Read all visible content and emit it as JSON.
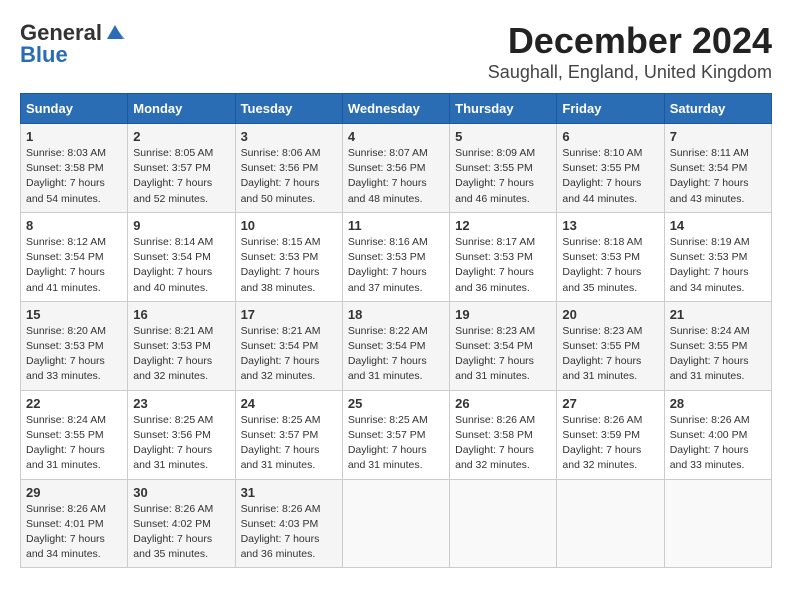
{
  "header": {
    "logo_general": "General",
    "logo_blue": "Blue",
    "month": "December 2024",
    "location": "Saughall, England, United Kingdom"
  },
  "days_of_week": [
    "Sunday",
    "Monday",
    "Tuesday",
    "Wednesday",
    "Thursday",
    "Friday",
    "Saturday"
  ],
  "weeks": [
    [
      {
        "day": 1,
        "sunrise": "8:03 AM",
        "sunset": "3:58 PM",
        "daylight": "7 hours and 54 minutes."
      },
      {
        "day": 2,
        "sunrise": "8:05 AM",
        "sunset": "3:57 PM",
        "daylight": "7 hours and 52 minutes."
      },
      {
        "day": 3,
        "sunrise": "8:06 AM",
        "sunset": "3:56 PM",
        "daylight": "7 hours and 50 minutes."
      },
      {
        "day": 4,
        "sunrise": "8:07 AM",
        "sunset": "3:56 PM",
        "daylight": "7 hours and 48 minutes."
      },
      {
        "day": 5,
        "sunrise": "8:09 AM",
        "sunset": "3:55 PM",
        "daylight": "7 hours and 46 minutes."
      },
      {
        "day": 6,
        "sunrise": "8:10 AM",
        "sunset": "3:55 PM",
        "daylight": "7 hours and 44 minutes."
      },
      {
        "day": 7,
        "sunrise": "8:11 AM",
        "sunset": "3:54 PM",
        "daylight": "7 hours and 43 minutes."
      }
    ],
    [
      {
        "day": 8,
        "sunrise": "8:12 AM",
        "sunset": "3:54 PM",
        "daylight": "7 hours and 41 minutes."
      },
      {
        "day": 9,
        "sunrise": "8:14 AM",
        "sunset": "3:54 PM",
        "daylight": "7 hours and 40 minutes."
      },
      {
        "day": 10,
        "sunrise": "8:15 AM",
        "sunset": "3:53 PM",
        "daylight": "7 hours and 38 minutes."
      },
      {
        "day": 11,
        "sunrise": "8:16 AM",
        "sunset": "3:53 PM",
        "daylight": "7 hours and 37 minutes."
      },
      {
        "day": 12,
        "sunrise": "8:17 AM",
        "sunset": "3:53 PM",
        "daylight": "7 hours and 36 minutes."
      },
      {
        "day": 13,
        "sunrise": "8:18 AM",
        "sunset": "3:53 PM",
        "daylight": "7 hours and 35 minutes."
      },
      {
        "day": 14,
        "sunrise": "8:19 AM",
        "sunset": "3:53 PM",
        "daylight": "7 hours and 34 minutes."
      }
    ],
    [
      {
        "day": 15,
        "sunrise": "8:20 AM",
        "sunset": "3:53 PM",
        "daylight": "7 hours and 33 minutes."
      },
      {
        "day": 16,
        "sunrise": "8:21 AM",
        "sunset": "3:53 PM",
        "daylight": "7 hours and 32 minutes."
      },
      {
        "day": 17,
        "sunrise": "8:21 AM",
        "sunset": "3:54 PM",
        "daylight": "7 hours and 32 minutes."
      },
      {
        "day": 18,
        "sunrise": "8:22 AM",
        "sunset": "3:54 PM",
        "daylight": "7 hours and 31 minutes."
      },
      {
        "day": 19,
        "sunrise": "8:23 AM",
        "sunset": "3:54 PM",
        "daylight": "7 hours and 31 minutes."
      },
      {
        "day": 20,
        "sunrise": "8:23 AM",
        "sunset": "3:55 PM",
        "daylight": "7 hours and 31 minutes."
      },
      {
        "day": 21,
        "sunrise": "8:24 AM",
        "sunset": "3:55 PM",
        "daylight": "7 hours and 31 minutes."
      }
    ],
    [
      {
        "day": 22,
        "sunrise": "8:24 AM",
        "sunset": "3:55 PM",
        "daylight": "7 hours and 31 minutes."
      },
      {
        "day": 23,
        "sunrise": "8:25 AM",
        "sunset": "3:56 PM",
        "daylight": "7 hours and 31 minutes."
      },
      {
        "day": 24,
        "sunrise": "8:25 AM",
        "sunset": "3:57 PM",
        "daylight": "7 hours and 31 minutes."
      },
      {
        "day": 25,
        "sunrise": "8:25 AM",
        "sunset": "3:57 PM",
        "daylight": "7 hours and 31 minutes."
      },
      {
        "day": 26,
        "sunrise": "8:26 AM",
        "sunset": "3:58 PM",
        "daylight": "7 hours and 32 minutes."
      },
      {
        "day": 27,
        "sunrise": "8:26 AM",
        "sunset": "3:59 PM",
        "daylight": "7 hours and 32 minutes."
      },
      {
        "day": 28,
        "sunrise": "8:26 AM",
        "sunset": "4:00 PM",
        "daylight": "7 hours and 33 minutes."
      }
    ],
    [
      {
        "day": 29,
        "sunrise": "8:26 AM",
        "sunset": "4:01 PM",
        "daylight": "7 hours and 34 minutes."
      },
      {
        "day": 30,
        "sunrise": "8:26 AM",
        "sunset": "4:02 PM",
        "daylight": "7 hours and 35 minutes."
      },
      {
        "day": 31,
        "sunrise": "8:26 AM",
        "sunset": "4:03 PM",
        "daylight": "7 hours and 36 minutes."
      },
      null,
      null,
      null,
      null
    ]
  ]
}
